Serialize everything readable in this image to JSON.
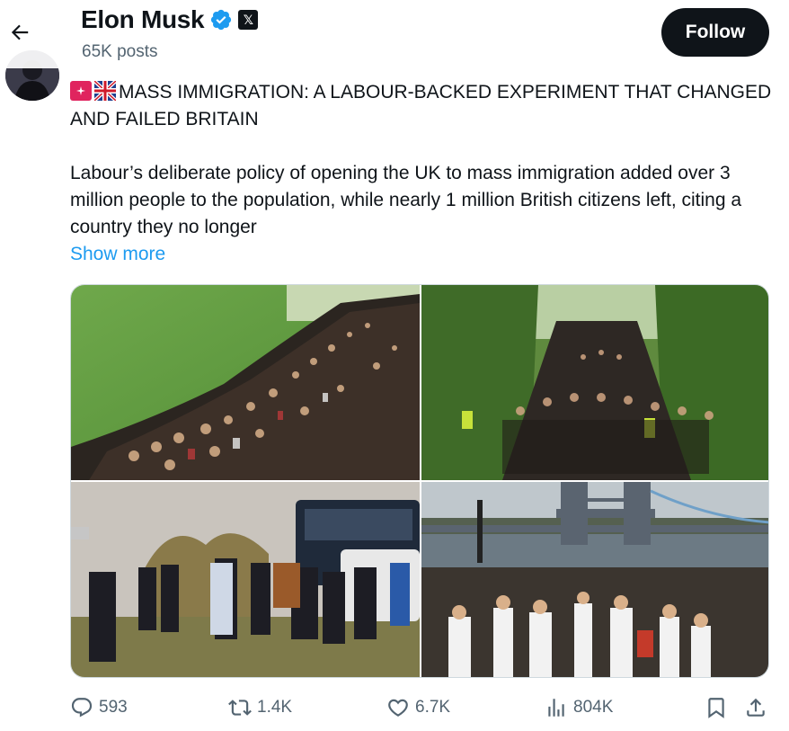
{
  "header": {
    "title": "Elon Musk",
    "posts_count": "65K posts",
    "follow_label": "Follow",
    "x_badge": "𝕏"
  },
  "tweet": {
    "headline": "MASS IMMIGRATION: A LABOUR-BACKED EXPERIMENT THAT CHANGED AND FAILED BRITAIN",
    "body": "Labour’s deliberate policy of opening the UK to mass immigration added over 3 million people to the population, while nearly 1 million British citizens left, citing a country they no longer",
    "show_more": "Show more",
    "emojis": [
      "rotating-light-icon",
      "uk-flag-icon"
    ]
  },
  "metrics": {
    "replies": "593",
    "reposts": "1.4K",
    "likes": "6.7K",
    "views": "804K"
  },
  "colors": {
    "accent": "#1d9bf0",
    "text": "#0f1419",
    "muted": "#536471",
    "button": "#0f1419"
  }
}
